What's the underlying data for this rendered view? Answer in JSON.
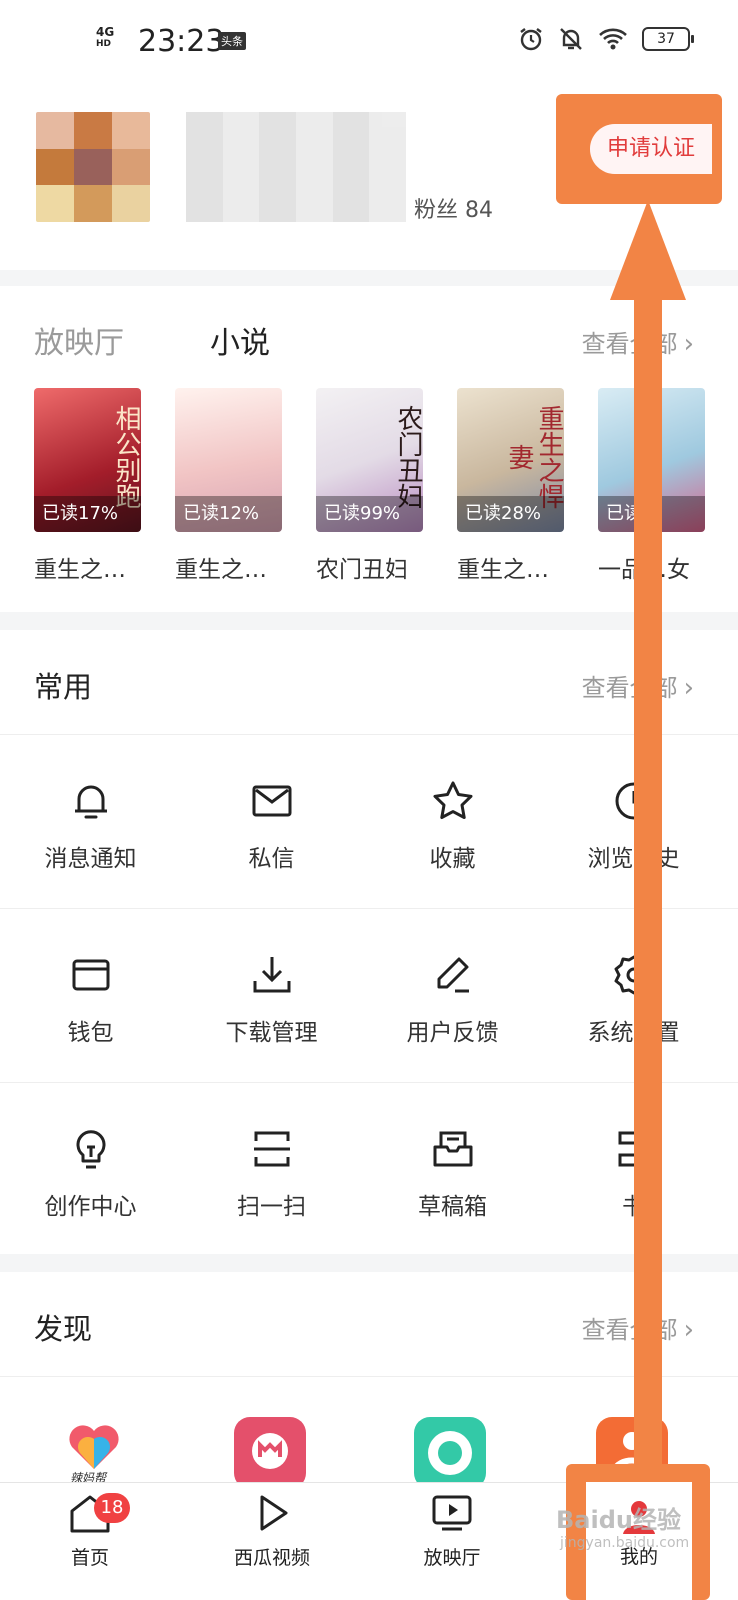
{
  "status_bar": {
    "network": "4G",
    "network_sub": "HD",
    "time": "23:23",
    "app_badge": "头条",
    "battery": "37"
  },
  "profile": {
    "stat_text": "粉丝 84",
    "apply_cert_label": "申请认证"
  },
  "novel_section": {
    "tabs": [
      "放映厅",
      "小说"
    ],
    "see_all": "查看全部",
    "books": [
      {
        "name": "重生之…",
        "progress": "已读17%",
        "cover_title": "相公别跑",
        "cover_color": "#c9333b"
      },
      {
        "name": "重生之…",
        "progress": "已读12%",
        "cover_title": "",
        "cover_color": "#f1dede"
      },
      {
        "name": "农门丑妇",
        "progress": "已读99%",
        "cover_title": "农门丑妇",
        "cover_color": "#ece8ef"
      },
      {
        "name": "重生之…",
        "progress": "已读28%",
        "cover_title": "重生之悍妻",
        "cover_color": "#d1c6b3"
      },
      {
        "name": "一品…女",
        "progress": "已读…",
        "cover_title": "",
        "cover_color": "#b9d7e6"
      }
    ]
  },
  "common_section": {
    "title": "常用",
    "see_all": "查看全部",
    "rows": [
      [
        {
          "label": "消息通知",
          "icon": "bell-icon"
        },
        {
          "label": "私信",
          "icon": "mail-icon"
        },
        {
          "label": "收藏",
          "icon": "star-icon"
        },
        {
          "label": "浏览历史",
          "icon": "clock-icon"
        }
      ],
      [
        {
          "label": "钱包",
          "icon": "wallet-icon"
        },
        {
          "label": "下载管理",
          "icon": "download-icon"
        },
        {
          "label": "用户反馈",
          "icon": "pen-icon"
        },
        {
          "label": "系统设置",
          "icon": "gear-icon"
        }
      ],
      [
        {
          "label": "创作中心",
          "icon": "bulb-icon"
        },
        {
          "label": "扫一扫",
          "icon": "scan-icon"
        },
        {
          "label": "草稿箱",
          "icon": "drafts-icon"
        },
        {
          "label": "书",
          "icon": "book-icon"
        }
      ]
    ]
  },
  "discover_section": {
    "title": "发现",
    "see_all": "查看全部",
    "apps": [
      {
        "name": "辣妈帮",
        "color": "#ffffff"
      },
      {
        "name": "",
        "color": "#e4506b"
      },
      {
        "name": "",
        "color": "#33c9a7"
      },
      {
        "name": "",
        "color": "#f36c35"
      }
    ]
  },
  "tabbar": {
    "items": [
      {
        "label": "首页",
        "badge": "18"
      },
      {
        "label": "西瓜视频"
      },
      {
        "label": "放映厅"
      },
      {
        "label": "我的"
      }
    ]
  },
  "watermark": {
    "text": "Baidu经验",
    "sub": "jingyan.baidu.com"
  },
  "colors": {
    "accent": "#f28445",
    "red": "#e13c3c",
    "badge": "#f04142"
  }
}
